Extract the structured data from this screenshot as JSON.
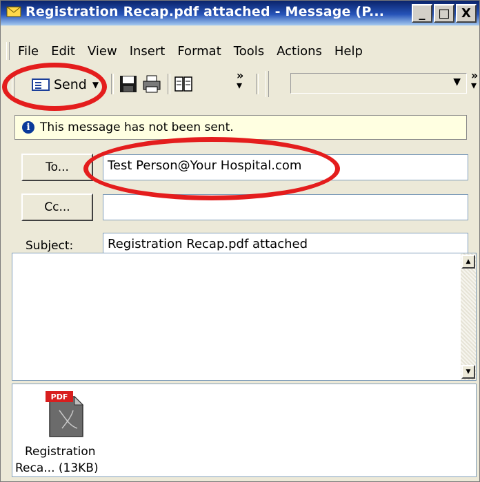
{
  "window": {
    "title": "Registration Recap.pdf attached - Message (P..."
  },
  "window_buttons": {
    "minimize": "_",
    "maximize": "□",
    "close": "X"
  },
  "menu": {
    "items": [
      "File",
      "Edit",
      "View",
      "Insert",
      "Format",
      "Tools",
      "Actions",
      "Help"
    ]
  },
  "toolbar": {
    "send_label": "Send"
  },
  "infobar": {
    "text": "This message has not been sent."
  },
  "fields": {
    "to_label": "To...",
    "to_value": "Test Person@Your Hospital.com",
    "cc_label": "Cc...",
    "cc_value": "",
    "subject_label": "Subject:",
    "subject_value": "Registration Recap.pdf attached"
  },
  "attachment": {
    "badge": "PDF",
    "name_line1": "Registration",
    "name_line2": "Reca... (13KB)"
  },
  "colors": {
    "highlight": "#e41d1d",
    "titlebar": "#0a246a",
    "info_bg": "#ffffe1"
  }
}
